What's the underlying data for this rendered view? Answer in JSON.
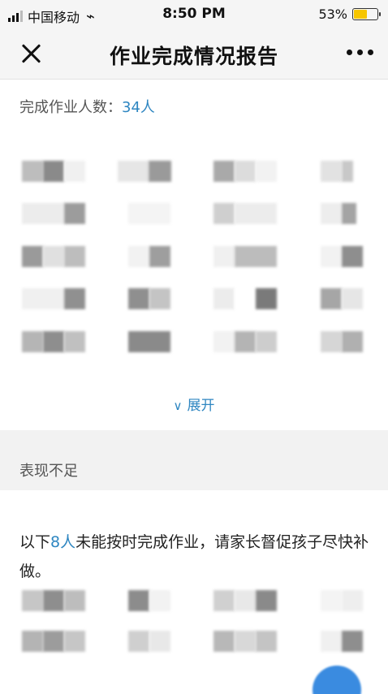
{
  "status_bar": {
    "carrier": "中国移动",
    "time": "8:50 PM",
    "battery": "53%",
    "battery_level_fraction": 0.53
  },
  "nav": {
    "title": "作业完成情况报告",
    "close_icon": "close-icon",
    "more_icon": "more-icon"
  },
  "completed": {
    "label": "完成作业人数：",
    "count": "34人"
  },
  "expand": {
    "label": "展开",
    "icon": "chevron-down-icon"
  },
  "underperform": {
    "header": "表现不足",
    "notice_prefix": "以下",
    "notice_count": "8人",
    "notice_suffix": "未能按时完成作业，请家长督促孩子尽快补做。"
  },
  "colors": {
    "accent": "#2e86c1",
    "section_band": "#f2f2f2"
  }
}
